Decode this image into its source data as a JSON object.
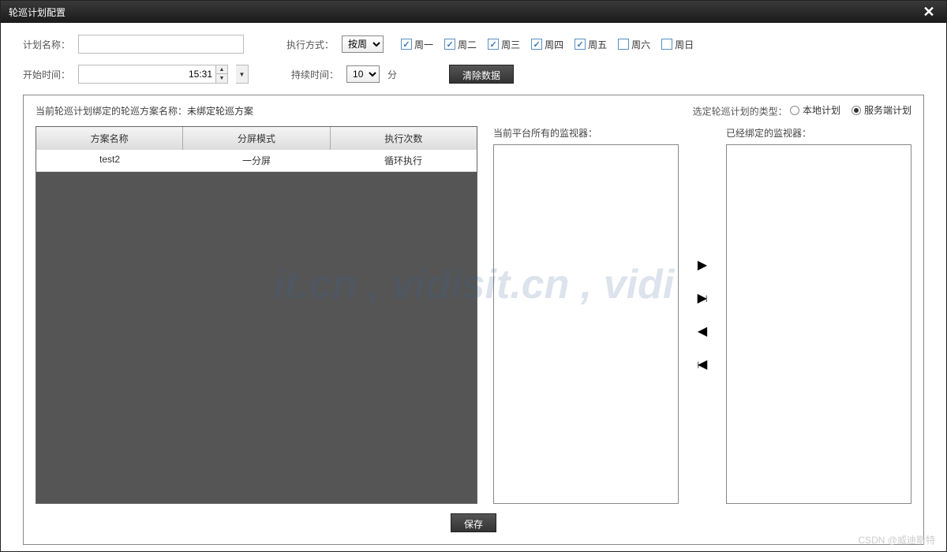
{
  "title": "轮巡计划配置",
  "form": {
    "planNameLabel": "计划名称：",
    "planNameValue": "",
    "execModeLabel": "执行方式：",
    "execModeValue": "按周",
    "startTimeLabel": "开始时间：",
    "startTimeValue": "15:31",
    "durationLabel": "持续时间：",
    "durationValue": "10",
    "durationUnit": "分",
    "clearDataLabel": "清除数据"
  },
  "weekdays": [
    {
      "label": "周一",
      "checked": true
    },
    {
      "label": "周二",
      "checked": true
    },
    {
      "label": "周三",
      "checked": true
    },
    {
      "label": "周四",
      "checked": true
    },
    {
      "label": "周五",
      "checked": true
    },
    {
      "label": "周六",
      "checked": false
    },
    {
      "label": "周日",
      "checked": false
    }
  ],
  "panel": {
    "bindingPrefix": "当前轮巡计划绑定的轮巡方案名称：",
    "bindingValue": "未绑定轮巡方案",
    "planTypeLabel": "选定轮巡计划的类型：",
    "planTypeOptions": [
      {
        "label": "本地计划",
        "selected": false
      },
      {
        "label": "服务端计划",
        "selected": true
      }
    ]
  },
  "table": {
    "headers": [
      "方案名称",
      "分屏模式",
      "执行次数"
    ],
    "rows": [
      {
        "name": "test2",
        "mode": "一分屏",
        "exec": "循环执行"
      }
    ]
  },
  "monitors": {
    "allLabel": "当前平台所有的监视器：",
    "boundLabel": "已经绑定的监视器："
  },
  "saveLabel": "保存",
  "watermark": "it.cn , vidisit.cn , vidi",
  "csdn": "CSDN @威迪斯特"
}
